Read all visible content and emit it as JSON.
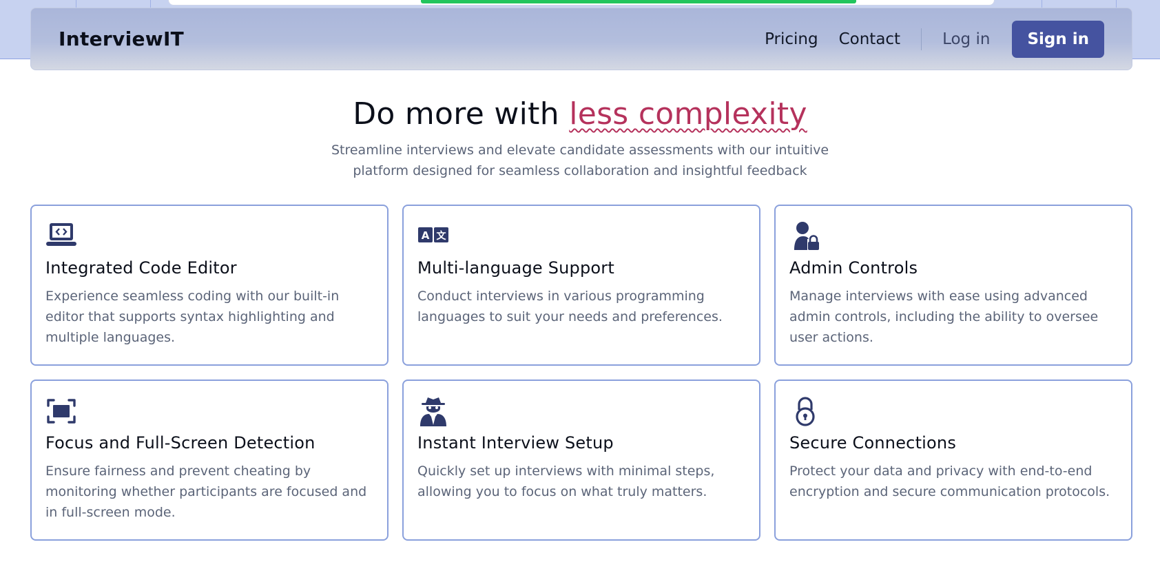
{
  "navbar": {
    "brand": "InterviewIT",
    "links": [
      "Pricing",
      "Contact"
    ],
    "login_label": "Log in",
    "signin_label": "Sign in"
  },
  "hero": {
    "title_plain": "Do more with ",
    "title_accent": "less complexity",
    "subtitle": "Streamline interviews and elevate candidate assessments with our intuitive platform designed for seamless collaboration and insightful feedback"
  },
  "features": [
    {
      "icon": "laptop-code-icon",
      "title": "Integrated Code Editor",
      "description": "Experience seamless coding with our built-in editor that supports syntax highlighting and multiple languages."
    },
    {
      "icon": "language-icon",
      "title": "Multi-language Support",
      "description": "Conduct interviews in various programming languages to suit your needs and preferences."
    },
    {
      "icon": "user-lock-icon",
      "title": "Admin Controls",
      "description": "Manage interviews with ease using advanced admin controls, including the ability to oversee user actions."
    },
    {
      "icon": "fullscreen-icon",
      "title": "Focus and Full-Screen Detection",
      "description": "Ensure fairness and prevent cheating by monitoring whether participants are focused and in full-screen mode."
    },
    {
      "icon": "user-secret-icon",
      "title": "Instant Interview Setup",
      "description": "Quickly set up interviews with minimal steps, allowing you to focus on what truly matters."
    },
    {
      "icon": "lock-icon",
      "title": "Secure Connections",
      "description": "Protect your data and privacy with end-to-end encryption and secure communication protocols."
    }
  ],
  "colors": {
    "accent": "#b5325c",
    "primary_button": "#4553a0",
    "card_border": "#8aa0dc",
    "icon": "#2f3a6b",
    "progress": "#22c55e"
  },
  "top_progress_fraction": 0.59
}
